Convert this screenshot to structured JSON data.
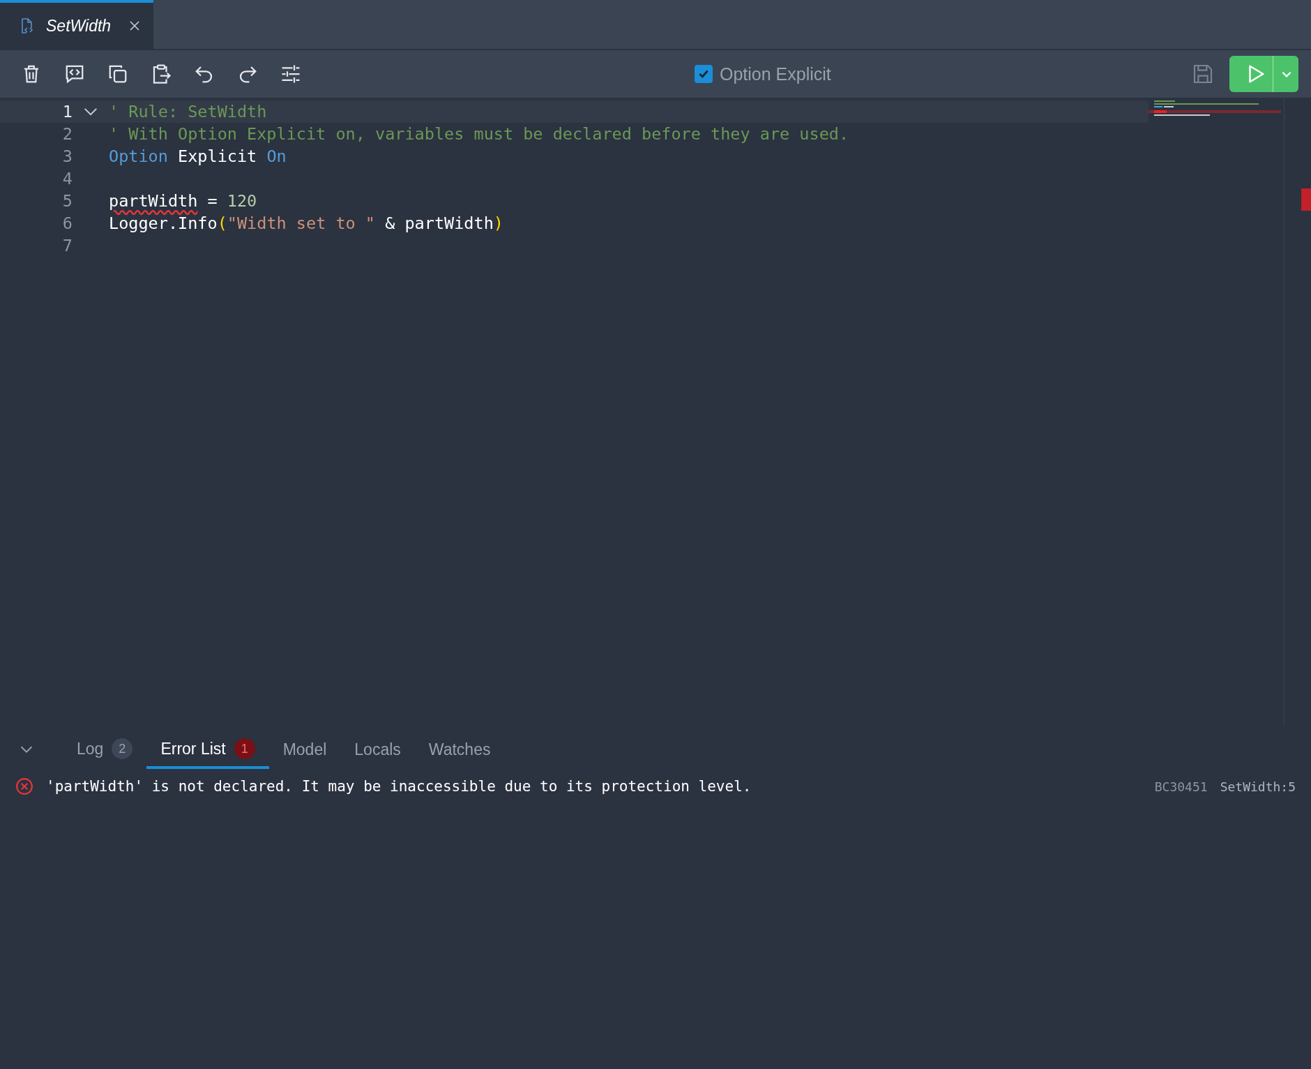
{
  "tab": {
    "title": "SetWidth",
    "selected": true
  },
  "toolbar": {
    "option_explicit": {
      "label": "Option Explicit",
      "checked": true
    }
  },
  "editor": {
    "lines": [
      {
        "number": "1",
        "current": true,
        "foldable": true,
        "tokens": [
          {
            "kind": "comment",
            "text": "' Rule: SetWidth"
          }
        ]
      },
      {
        "number": "2",
        "current": false,
        "foldable": false,
        "tokens": [
          {
            "kind": "comment",
            "text": "' With Option Explicit on, variables must be declared before they are used."
          }
        ]
      },
      {
        "number": "3",
        "current": false,
        "foldable": false,
        "tokens": [
          {
            "kind": "keyword",
            "text": "Option"
          },
          {
            "kind": "plain",
            "text": " Explicit "
          },
          {
            "kind": "keyword",
            "text": "On"
          }
        ]
      },
      {
        "number": "4",
        "current": false,
        "foldable": false
      },
      {
        "number": "5",
        "current": false,
        "foldable": false,
        "tokens": [
          {
            "kind": "plain",
            "text": "partWidth",
            "error": true
          },
          {
            "kind": "plain",
            "text": " = "
          },
          {
            "kind": "number",
            "text": "120"
          }
        ]
      },
      {
        "number": "6",
        "current": false,
        "foldable": false,
        "tokens": [
          {
            "kind": "plain",
            "text": "Logger.Info"
          },
          {
            "kind": "paren",
            "text": "("
          },
          {
            "kind": "string",
            "text": "\"Width set to \""
          },
          {
            "kind": "plain",
            "text": " & partWidth"
          },
          {
            "kind": "paren",
            "text": ")"
          }
        ]
      },
      {
        "number": "7",
        "current": false,
        "foldable": false
      }
    ]
  },
  "panel": {
    "expanded": true,
    "tabs": [
      {
        "label": "Log",
        "count": "2",
        "alert": false,
        "selected": false
      },
      {
        "label": "Error List",
        "count": "1",
        "alert": true,
        "selected": true
      },
      {
        "label": "Model",
        "selected": false
      },
      {
        "label": "Locals",
        "selected": false
      },
      {
        "label": "Watches",
        "selected": false
      }
    ],
    "errors": [
      {
        "message": "'partWidth' is not declared. It may be inaccessible due to its protection level.",
        "code": "BC30451",
        "location": "SetWidth:5"
      }
    ]
  }
}
